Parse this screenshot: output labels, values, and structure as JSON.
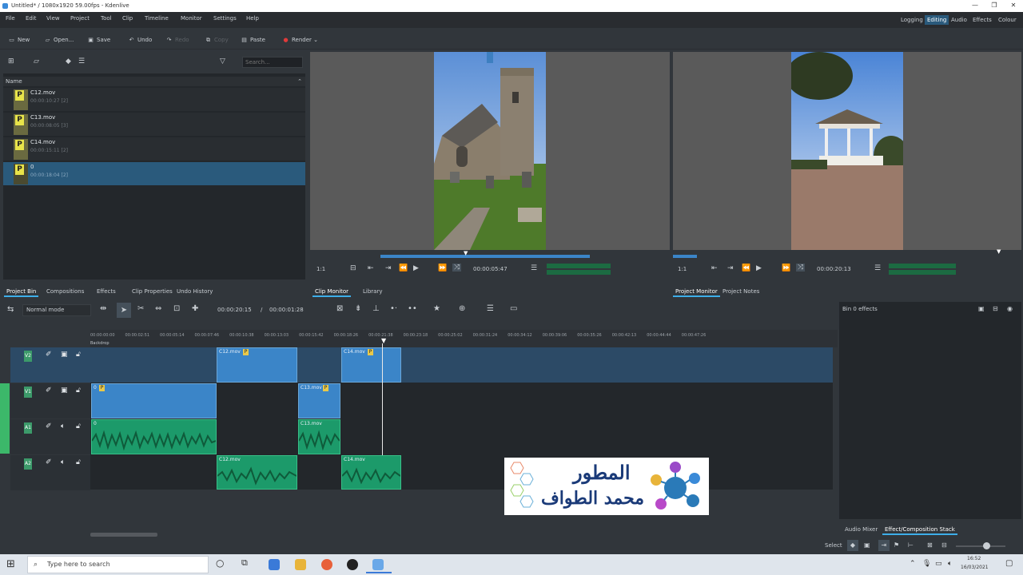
{
  "window": {
    "title": "Untitled* / 1080x1920 59.00fps - Kdenlive",
    "minimize": "—",
    "maximize": "❐",
    "close": "✕"
  },
  "menu": [
    "File",
    "Edit",
    "View",
    "Project",
    "Tool",
    "Clip",
    "Timeline",
    "Monitor",
    "Settings",
    "Help"
  ],
  "workspaces": {
    "items": [
      "Logging",
      "Editing",
      "Audio",
      "Effects",
      "Colour"
    ],
    "active": "Editing"
  },
  "toolbar": {
    "new": "New",
    "open": "Open...",
    "save": "Save",
    "undo": "Undo",
    "redo": "Redo",
    "copy": "Copy",
    "paste": "Paste",
    "render": "Render"
  },
  "bin": {
    "search_placeholder": "Search...",
    "header": "Name",
    "items": [
      {
        "name": "C12.mov",
        "sub": "00:00:10:27 [2]",
        "selected": false
      },
      {
        "name": "C13.mov",
        "sub": "00:00:08:05 [3]",
        "selected": false
      },
      {
        "name": "C14.mov",
        "sub": "00:00:15:11 [2]",
        "selected": false
      },
      {
        "name": "0",
        "sub": "00:00:18:04 [2]",
        "selected": true
      }
    ]
  },
  "left_tabs": [
    "Project Bin",
    "Compositions",
    "Effects",
    "Clip Properties",
    "Undo History"
  ],
  "clip_monitor": {
    "zoom": "1:1",
    "timecode": "00:00:05:47",
    "tabs": [
      "Clip Monitor",
      "Library"
    ]
  },
  "project_monitor": {
    "zoom": "1:1",
    "timecode": "00:00:20:13",
    "tabs": [
      "Project Monitor",
      "Project Notes"
    ]
  },
  "timeline": {
    "mode": "Normal mode",
    "position": "00:00:20:15",
    "duration": "00:00:01:28",
    "ruler": [
      "00:00:00:00",
      "00:00:02:51",
      "00:00:05:14",
      "00:00:07:46",
      "00:00:10:38",
      "00:00:13:03",
      "00:00:15:42",
      "00:00:18:26",
      "00:00:21:38",
      "00:00:23:18",
      "00:00:25:02",
      "00:00:31:24",
      "00:00:34:12",
      "00:00:39:06",
      "00:00:35:26",
      "00:00:42:13",
      "00:00:44:44",
      "00:00:47:26",
      "00:00:50:00"
    ],
    "tracks": [
      {
        "label": "V2",
        "type": "video"
      },
      {
        "label": "V1",
        "type": "video"
      },
      {
        "label": "A1",
        "type": "audio"
      },
      {
        "label": "A2",
        "type": "audio"
      }
    ],
    "clips": {
      "v2_a": "C12.mov",
      "v2_b": "C14.mov",
      "v1_a": "0",
      "v1_b": "C13.mov",
      "a1_a": "0",
      "a1_b": "C13.mov",
      "a2_a": "C12.mov",
      "a2_b": "C14.mov"
    },
    "track_label": "Backdrop"
  },
  "effects_panel": {
    "title": "Bin 0 effects",
    "tabs": [
      "Audio Mixer",
      "Effect/Composition Stack"
    ]
  },
  "statusbar": {
    "select": "Select"
  },
  "logo": {
    "line1": "المطور",
    "line2": "محمد الطواف"
  },
  "taskbar": {
    "search": "Type here to search",
    "time": "16:52",
    "date": "16/03/2021"
  }
}
